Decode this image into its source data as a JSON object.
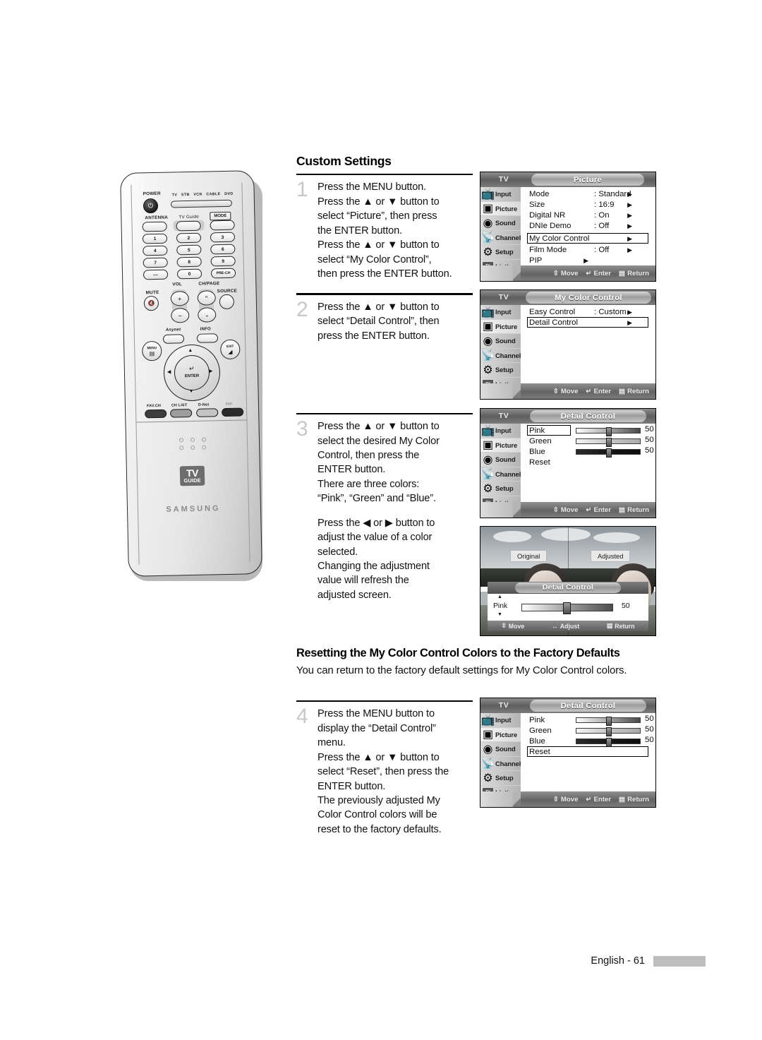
{
  "page": {
    "section_title": "Custom Settings",
    "subsection_title": "Resetting the My Color Control Colors to the Factory Defaults",
    "subsection_body": "You can return to the factory default settings for My Color Control colors.",
    "footer_page": "English - 61"
  },
  "steps": [
    {
      "number": "1",
      "lines": [
        "Press the MENU button.",
        "Press the ▲ or ▼ button to",
        "select “Picture”, then press",
        "the ENTER button.",
        "Press the ▲ or ▼ button to",
        "select “My Color Control”,",
        "then press the ENTER button."
      ]
    },
    {
      "number": "2",
      "lines": [
        "Press the ▲ or ▼ button to",
        "select “Detail Control”, then",
        "press the ENTER button."
      ]
    },
    {
      "number": "3",
      "lines": [
        "Press the ▲ or ▼ button to",
        "select the desired My Color",
        "Control, then press the",
        "ENTER button.",
        "There are three colors:",
        "“Pink”, “Green” and “Blue”.",
        "",
        "Press the ◀ or ▶ button to",
        "adjust the value of a color",
        "selected.",
        "Changing the adjustment",
        "value will refresh the",
        "adjusted screen."
      ]
    },
    {
      "number": "4",
      "lines": [
        "Press the MENU button to",
        "display the “Detail Control”",
        "menu.",
        "Press the ▲ or ▼ button to",
        "select “Reset”, then press the",
        "ENTER button.",
        "The previously adjusted My",
        "Color Control colors will be",
        "reset to the factory defaults."
      ]
    }
  ],
  "osd": {
    "tv_label": "TV",
    "sidebar": [
      {
        "label": "Input",
        "icon": "input-icon"
      },
      {
        "label": "Picture",
        "icon": "picture-icon"
      },
      {
        "label": "Sound",
        "icon": "sound-icon"
      },
      {
        "label": "Channel",
        "icon": "channel-icon"
      },
      {
        "label": "Setup",
        "icon": "setup-icon"
      },
      {
        "label": "Listings",
        "icon": "tvguide-icon"
      }
    ],
    "hints": {
      "move": "Move",
      "enter": "Enter",
      "return": "Return",
      "adjust": "Adjust"
    },
    "arrow": "▶",
    "menu_picture": {
      "title": "Picture",
      "rows": [
        {
          "label": "Mode",
          "value": ": Standard",
          "arrow": "▶",
          "highlighted": false
        },
        {
          "label": "Size",
          "value": ": 16:9",
          "arrow": "▶",
          "highlighted": false
        },
        {
          "label": "Digital NR",
          "value": ": On",
          "arrow": "▶",
          "highlighted": false
        },
        {
          "label": "DNIe Demo",
          "value": ": Off",
          "arrow": "▶",
          "highlighted": false
        },
        {
          "label": "My Color Control",
          "value": "",
          "arrow": "▶",
          "highlighted": true
        },
        {
          "label": "Film Mode",
          "value": ": Off",
          "arrow": "▶",
          "highlighted": false
        },
        {
          "label": "PIP",
          "value": "",
          "arrow": "▶",
          "highlighted": false
        }
      ]
    },
    "menu_mycolor": {
      "title": "My Color Control",
      "rows": [
        {
          "label": "Easy Control",
          "value": ": Custom",
          "arrow": "▶",
          "highlighted": false
        },
        {
          "label": "Detail Control",
          "value": "",
          "arrow": "▶",
          "highlighted": true
        }
      ]
    },
    "menu_detail": {
      "title": "Detail Control",
      "rows": [
        {
          "label": "Pink",
          "value": "50",
          "highlighted": true
        },
        {
          "label": "Green",
          "value": "50",
          "highlighted": false
        },
        {
          "label": "Blue",
          "value": "50",
          "highlighted": false
        },
        {
          "label": "Reset",
          "value": "",
          "highlighted": false
        }
      ]
    },
    "menu_detail_reset": {
      "title": "Detail Control",
      "rows": [
        {
          "label": "Pink",
          "value": "50",
          "highlighted": false
        },
        {
          "label": "Green",
          "value": "50",
          "highlighted": false
        },
        {
          "label": "Blue",
          "value": "50",
          "highlighted": false
        },
        {
          "label": "Reset",
          "value": "",
          "highlighted": true
        }
      ]
    },
    "preview": {
      "label_original": "Original",
      "label_adjusted": "Adjusted",
      "title": "Detail Control",
      "slider_label": "Pink",
      "slider_value": "50",
      "up_arrow": "▲",
      "down_arrow": "▼"
    }
  },
  "remote": {
    "power_label": "POWER",
    "mode_strip": [
      "TV",
      "STB",
      "VCR",
      "CABLE",
      "DVD"
    ],
    "row_labels": {
      "antenna": "ANTENNA",
      "tvguide": "TV Guide",
      "mode": "MODE"
    },
    "keypad": [
      "1",
      "2",
      "3",
      "4",
      "5",
      "6",
      "7",
      "8",
      "9",
      "—",
      "0",
      "PRE-CH"
    ],
    "vol_label": "VOL",
    "chpage_label": "CH/PAGE",
    "mute_label": "MUTE",
    "source_label": "SOURCE",
    "anynet_label": "Anynet",
    "info_label": "INFO",
    "menu_label": "MENU",
    "exit_label": "EXIT",
    "enter_label": "ENTER",
    "bottom_buttons": [
      "FAV.CH",
      "CH LIST",
      "D-Net",
      "PIP"
    ],
    "tvguide_logo_top": "TV",
    "tvguide_logo_bottom": "GUIDE",
    "brand": "SAMSUNG"
  },
  "colors": {
    "slider_pink_from": "#ffffff",
    "slider_pink_to": "#4a4a4a",
    "slider_green_from": "#f2f2f2",
    "slider_green_to": "#b5b5b5",
    "slider_blue_from": "#2b2b2b",
    "slider_blue_to": "#111111",
    "number_gray": "#c8c8c8",
    "osd_bar": "#646464"
  }
}
